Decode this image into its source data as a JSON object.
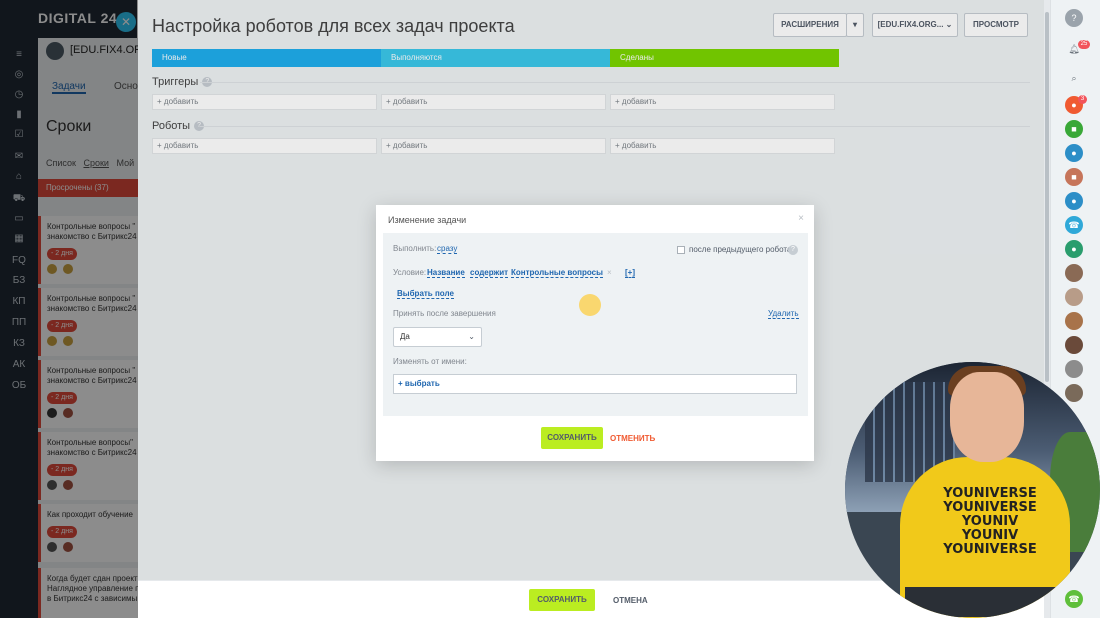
{
  "app": {
    "brand": "DIGITAL 24",
    "close_icon": "close-icon",
    "nav_icons": [
      "filter-icon",
      "target-icon",
      "clock-icon",
      "chart-icon",
      "check-icon",
      "mail-icon",
      "home-icon",
      "cart-icon",
      "chat-icon",
      "grid-icon"
    ],
    "nav_labels": [
      "FQ",
      "БЗ",
      "КП",
      "ПП",
      "КЗ",
      "АК",
      "ОБ"
    ]
  },
  "background_page": {
    "user": "[EDU.FIX4.ORG",
    "tabs": [
      "Задачи",
      "Осно"
    ],
    "title": "Сроки",
    "subtabs": [
      "Список",
      "Сроки",
      "Мой"
    ],
    "overdue_label": "Просрочены",
    "overdue_count": "(37)",
    "cards": [
      {
        "line1": "Контрольные вопросы \"",
        "line2": "знакомство с Битрикс24",
        "badge": "- 2 дня"
      },
      {
        "line1": "Контрольные вопросы \"",
        "line2": "знакомство с Битрикс24",
        "badge": "- 2 дня"
      },
      {
        "line1": "Контрольные вопросы \"",
        "line2": "знакомство с Битрикс24",
        "badge": "- 2 дня"
      },
      {
        "line1": "Контрольные вопросы\"",
        "line2": "знакомство с Битрикс24",
        "badge": "- 2 дня"
      },
      {
        "line1": "Как проходит обучение",
        "line2": "",
        "badge": "- 2 дня"
      },
      {
        "line1": "Когда будет сдан проект",
        "line2": "Наглядное управление п",
        "line3": "в Битрикс24 с зависимы",
        "badge": ""
      }
    ]
  },
  "panel": {
    "title": "Настройка роботов для всех задач проекта",
    "buttons": {
      "extensions": "РАСШИРЕНИЯ",
      "portal": "[EDU.FIX4.ORG...",
      "view": "ПРОСМОТР"
    },
    "stages": [
      {
        "name": "Новые",
        "color": "#1faeed"
      },
      {
        "name": "Выполняются",
        "color": "#3bc8eb"
      },
      {
        "name": "Сделаны",
        "color": "#7bd500"
      }
    ],
    "triggers_label": "Триггеры",
    "robots_label": "Роботы",
    "add_label": "+ добавить",
    "footer": {
      "save": "СОХРАНИТЬ",
      "cancel": "ОТМЕНА"
    }
  },
  "modal": {
    "title": "Изменение задачи",
    "execute_label": "Выполнить:",
    "execute_value": "сразу",
    "after_prev_label": "после предыдущего робота",
    "condition_label": "Условие:",
    "condition_field": "Название",
    "condition_op": "содержит",
    "condition_value": "Контрольные вопросы",
    "condition_remove": "×",
    "condition_add": "[+]",
    "select_field": "Выбрать поле",
    "accept_label": "Принять после завершения",
    "delete_link": "Удалить",
    "accept_value": "Да",
    "change_by_label": "Изменять от имени:",
    "pick_label": "+ выбрать",
    "save": "СОХРАНИТЬ",
    "cancel": "ОТМЕНИТЬ"
  },
  "right_sidebar": {
    "notification_count": "25",
    "user_badge": "3",
    "icons": [
      "help-icon",
      "bell-icon",
      "search-icon"
    ]
  },
  "webcam": {
    "shirt_text": [
      "YOUNIVERSE",
      "YOUNIVERSE",
      "YOUNIV",
      "YOUNIV",
      "YOUNIVERSE"
    ]
  }
}
